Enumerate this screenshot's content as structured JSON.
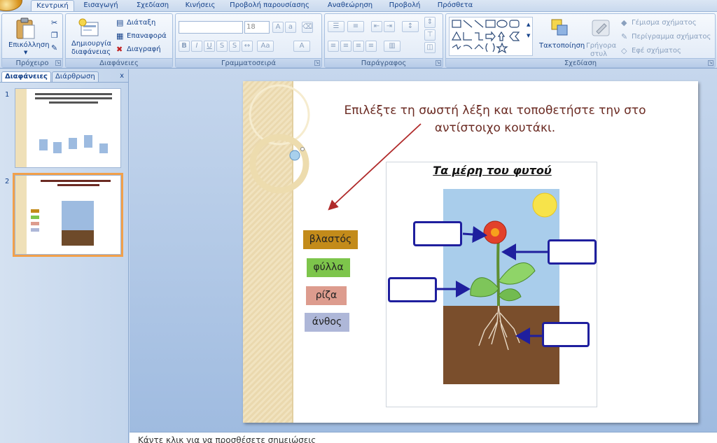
{
  "ribbon_tabs": [
    "Κεντρική",
    "Εισαγωγή",
    "Σχεδίαση",
    "Κινήσεις",
    "Προβολή παρουσίασης",
    "Αναθεώρηση",
    "Προβολή",
    "Πρόσθετα"
  ],
  "groups": {
    "clipboard": {
      "label": "Πρόχειρο",
      "paste": "Επικόλληση",
      "paste_icon": "clipboard-icon",
      "cut_icon": "scissors-icon",
      "copy_icon": "copy-icon",
      "format_painter_icon": "brush-icon"
    },
    "slides": {
      "label": "Διαφάνειες",
      "new_slide_line1": "Δημιουργία",
      "new_slide_line2": "διαφάνειας",
      "layout": "Διάταξη",
      "reset": "Επαναφορά",
      "delete": "Διαγραφή"
    },
    "font": {
      "label": "Γραμματοσειρά",
      "font_name_value": "",
      "font_size_value": "18"
    },
    "paragraph": {
      "label": "Παράγραφος"
    },
    "drawing": {
      "label": "Σχεδίαση",
      "arrange": "Τακτοποίηση",
      "quick_styles_line1": "Γρήγορα",
      "quick_styles_line2": "στυλ",
      "shape_fill": "Γέμισμα σχήματος",
      "shape_outline": "Περίγραμμα σχήματος",
      "shape_effects": "Εφέ σχήματος"
    }
  },
  "slides_panel": {
    "tab_slides": "Διαφάνειες",
    "tab_outline": "Διάρθρωση",
    "close": "x",
    "slide_numbers": [
      "1",
      "2"
    ],
    "selected_slide": 2
  },
  "slide": {
    "instruction": "Επιλέξτε τη σωστή λέξη και τοποθετήστε την στο αντίστοιχο κουτάκι.",
    "words": [
      {
        "text": "βλαστός",
        "color": "#c38b1a"
      },
      {
        "text": "φύλλα",
        "color": "#7dc54b"
      },
      {
        "text": "ρίζα",
        "color": "#dd9c8e"
      },
      {
        "text": "άνθος",
        "color": "#aeb7d8"
      }
    ],
    "diagram_title": "Τα μέρη του φυτού",
    "answer_box_count": 4
  },
  "notes": {
    "text": "Κάντε κλικ για να προσθέσετε σημειώσεις"
  },
  "colors": {
    "accent_orange": "#f2a04a",
    "title_text": "#6b2b23",
    "arrow_red": "#b02a2a",
    "box_blue": "#1f1f9e"
  }
}
